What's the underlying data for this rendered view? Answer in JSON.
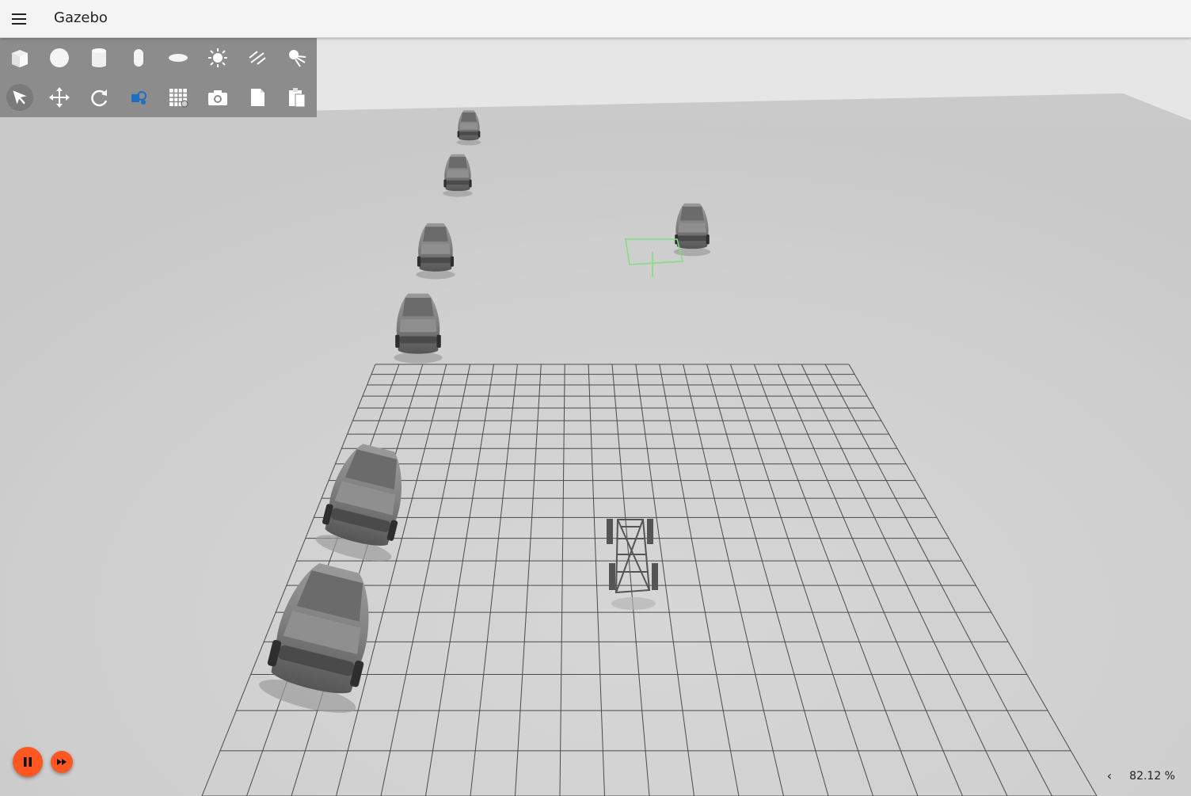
{
  "app": {
    "title": "Gazebo"
  },
  "toolbar": {
    "row1": [
      {
        "name": "box-shape-icon",
        "tool": "box"
      },
      {
        "name": "sphere-shape-icon",
        "tool": "sphere"
      },
      {
        "name": "cylinder-shape-icon",
        "tool": "cylinder"
      },
      {
        "name": "capsule-shape-icon",
        "tool": "capsule"
      },
      {
        "name": "ellipsoid-shape-icon",
        "tool": "ellipsoid"
      },
      {
        "name": "point-light-icon",
        "tool": "point-light"
      },
      {
        "name": "directional-light-icon",
        "tool": "directional-light"
      },
      {
        "name": "spot-light-icon",
        "tool": "spot-light"
      }
    ],
    "row2": [
      {
        "name": "select-arrow-icon",
        "tool": "select",
        "active": true
      },
      {
        "name": "translate-icon",
        "tool": "translate"
      },
      {
        "name": "rotate-icon",
        "tool": "rotate"
      },
      {
        "name": "transform-control-icon",
        "tool": "view-collisions"
      },
      {
        "name": "grid-snap-icon",
        "tool": "snap"
      },
      {
        "name": "screenshot-camera-icon",
        "tool": "screenshot"
      },
      {
        "name": "copy-icon",
        "tool": "copy"
      },
      {
        "name": "paste-icon",
        "tool": "paste"
      }
    ]
  },
  "playback": {
    "pause_label": "pause",
    "ff_label": "step"
  },
  "stats": {
    "rtf": "82.12 %",
    "toggle": "‹"
  },
  "colors": {
    "accent": "#ff5722",
    "toolbar": "#8c8c8c",
    "ground": "#d2d2d2",
    "sky": "#e4e4e4"
  }
}
